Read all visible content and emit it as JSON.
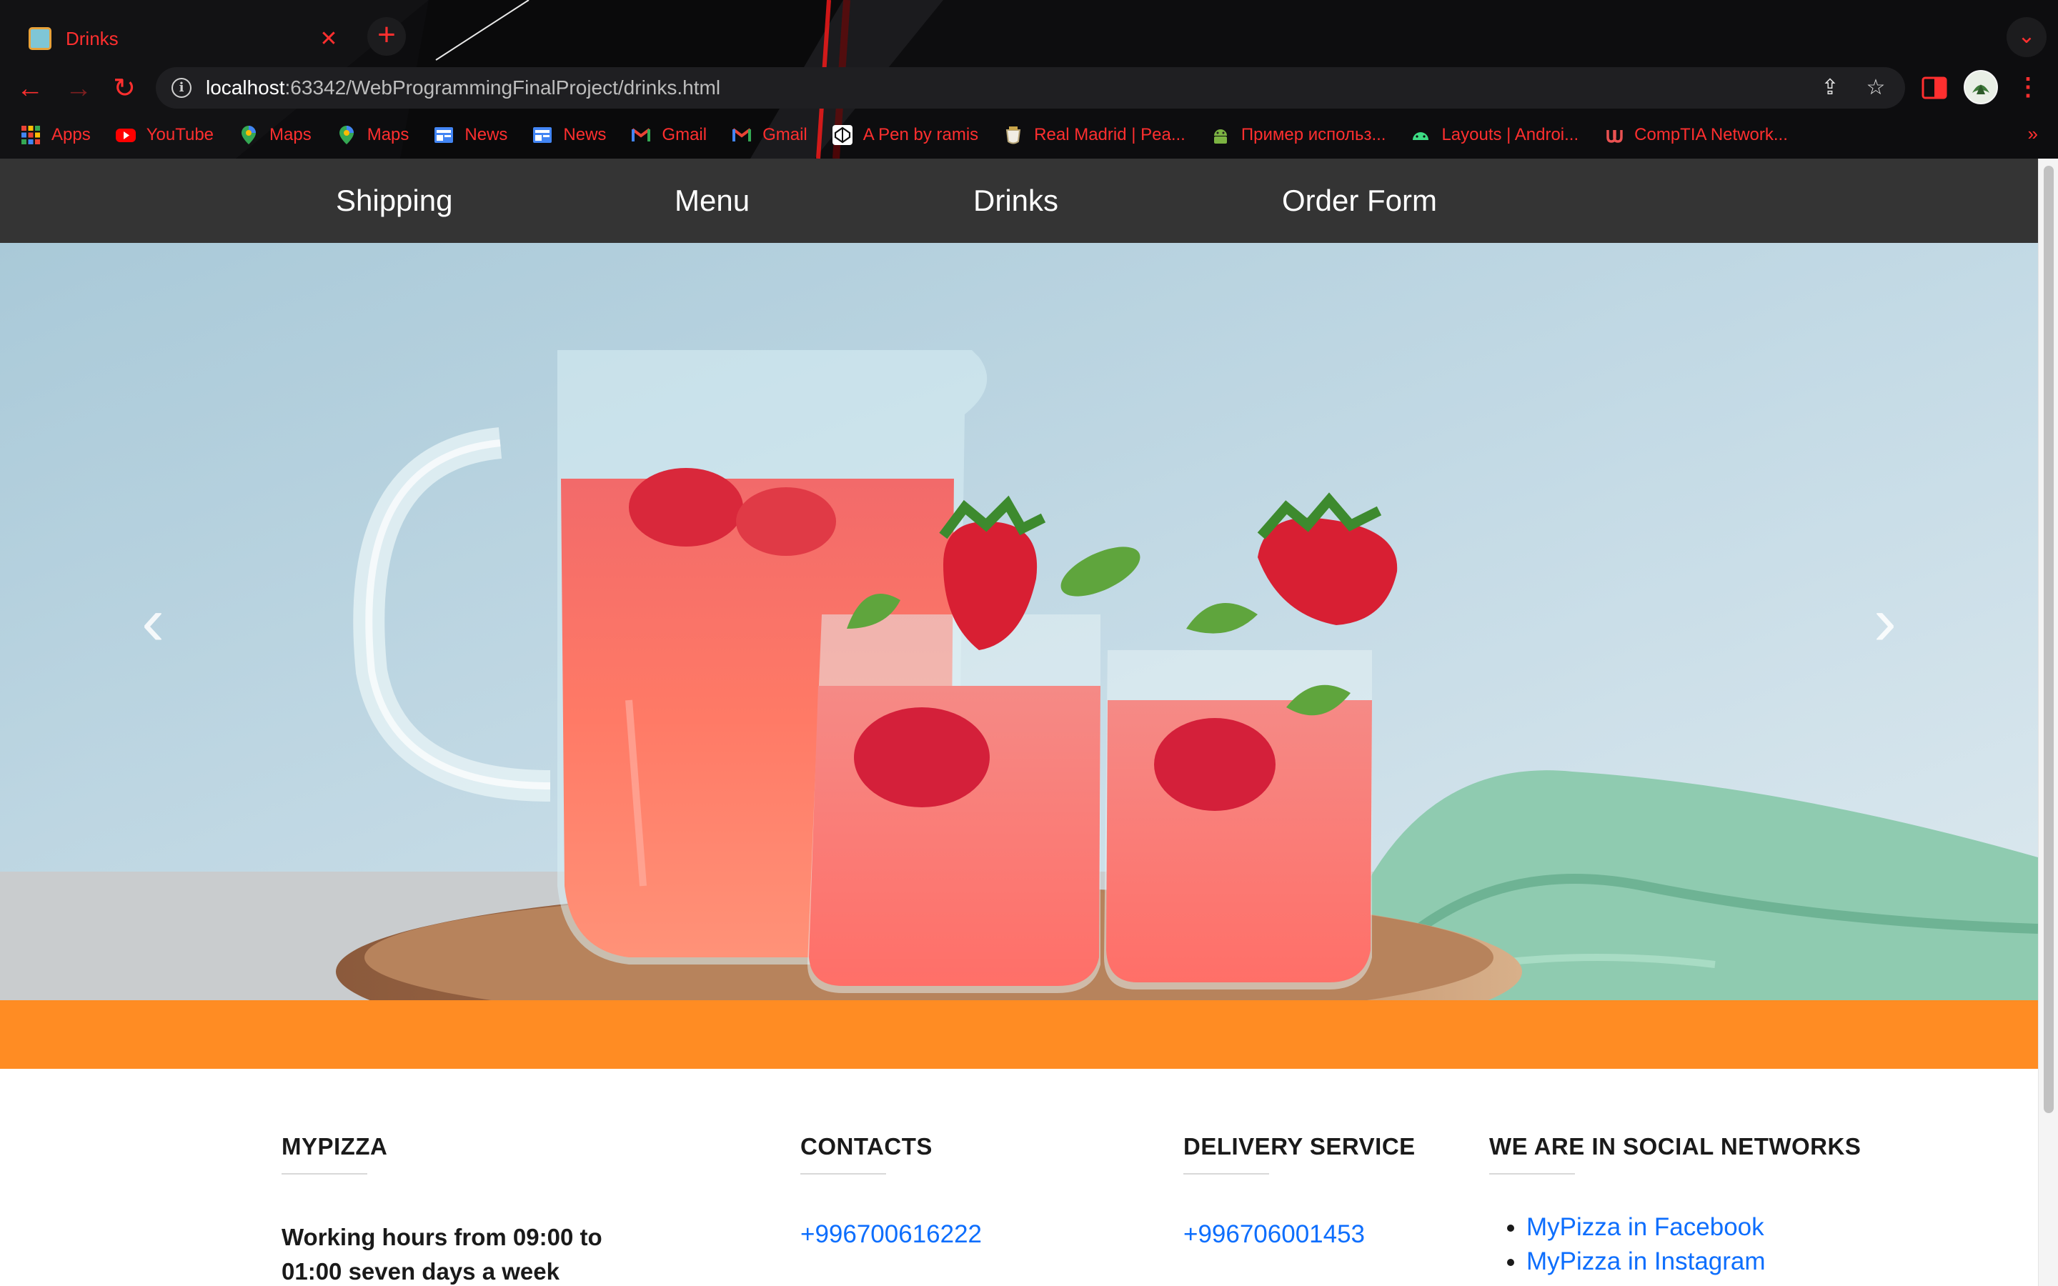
{
  "browser": {
    "tab_title": "Drinks",
    "url_host": "localhost",
    "url_rest": ":63342/WebProgrammingFinalProject/drinks.html",
    "accent_color": "#ff2f2f",
    "bookmarks": [
      {
        "label": "Apps",
        "icon": "apps-grid-icon"
      },
      {
        "label": "YouTube",
        "icon": "youtube-icon"
      },
      {
        "label": "Maps",
        "icon": "maps-pin-icon"
      },
      {
        "label": "Maps",
        "icon": "maps-pin-icon"
      },
      {
        "label": "News",
        "icon": "news-icon"
      },
      {
        "label": "News",
        "icon": "news-icon"
      },
      {
        "label": "Gmail",
        "icon": "gmail-icon"
      },
      {
        "label": "Gmail",
        "icon": "gmail-icon"
      },
      {
        "label": "A Pen by ramis",
        "icon": "codepen-icon"
      },
      {
        "label": "Real Madrid | Pea...",
        "icon": "real-madrid-icon"
      },
      {
        "label": "Пример использ...",
        "icon": "android-icon"
      },
      {
        "label": "Layouts  |  Androi...",
        "icon": "android-icon"
      },
      {
        "label": "CompTIA Network...",
        "icon": "udemy-icon"
      }
    ],
    "bookmarks_more": "»"
  },
  "site_nav": {
    "items": [
      "Shipping",
      "Menu",
      "Drinks",
      "Order Form"
    ]
  },
  "carousel": {
    "prev_label": "‹",
    "next_label": "›",
    "slide_count": 3,
    "active_index": 2
  },
  "colors": {
    "nav_bg": "#343434",
    "orange_band": "#ff8c23",
    "link": "#0d6efd"
  },
  "footer": {
    "mypizza": {
      "title": "MYPIZZA",
      "hours": "Working hours from 09:00 to 01:00 seven days a week"
    },
    "contacts": {
      "title": "CONTACTS",
      "phone": "+996700616222"
    },
    "delivery": {
      "title": "DELIVERY SERVICE",
      "phone": "+996706001453"
    },
    "social": {
      "title": "WE ARE IN SOCIAL NETWORKS",
      "links": [
        "MyPizza in Facebook",
        "MyPizza in Instagram"
      ]
    }
  }
}
